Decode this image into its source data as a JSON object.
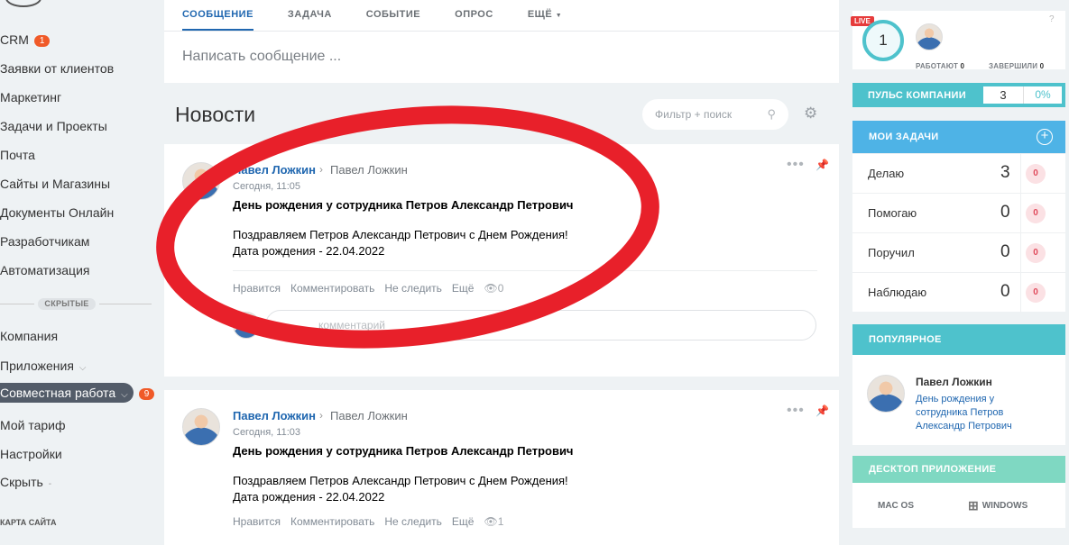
{
  "sidebar": {
    "items": [
      {
        "label": "CRM",
        "badge": "1"
      },
      {
        "label": "Заявки от клиентов"
      },
      {
        "label": "Маркетинг"
      },
      {
        "label": "Задачи и Проекты"
      },
      {
        "label": "Почта"
      },
      {
        "label": "Сайты и Магазины"
      },
      {
        "label": "Документы Онлайн"
      },
      {
        "label": "Разработчикам"
      },
      {
        "label": "Автоматизация"
      }
    ],
    "hidden_label": "СКРЫТЫЕ",
    "hidden_items": [
      {
        "label": "Компания"
      },
      {
        "label": "Приложения"
      },
      {
        "label": "Совместная работа",
        "badge": "9"
      },
      {
        "label": "Мой тариф"
      },
      {
        "label": "Настройки"
      },
      {
        "label": "Скрыть"
      }
    ],
    "sitemap": "КАРТА САЙТА"
  },
  "composer": {
    "tabs": [
      "СООБЩЕНИЕ",
      "ЗАДАЧА",
      "СОБЫТИЕ",
      "ОПРОС",
      "ЕЩЁ"
    ],
    "placeholder": "Написать сообщение ..."
  },
  "feed": {
    "title": "Новости",
    "filter_placeholder": "Фильтр + поиск",
    "posts": [
      {
        "author": "Павел Ложкин",
        "recipient": "Павел Ложкин",
        "time": "Сегодня, 11:05",
        "title": "День рождения у сотрудника Петров Александр Петрович",
        "body_line1": "Поздравляем Петров Александр Петрович с Днем Рождения!",
        "body_line2": "Дата рождения - 22.04.2022",
        "actions": {
          "like": "Нравится",
          "comment": "Комментировать",
          "unfollow": "Не следить",
          "more": "Ещё"
        },
        "views": "0",
        "comment_placeholder": "комментарий"
      },
      {
        "author": "Павел Ложкин",
        "recipient": "Павел Ложкин",
        "time": "Сегодня, 11:03",
        "title": "День рождения у сотрудника Петров Александр Петрович",
        "body_line1": "Поздравляем Петров Александр Петрович с Днем Рождения!",
        "body_line2": "Дата рождения - 22.04.2022",
        "actions": {
          "like": "Нравится",
          "comment": "Комментировать",
          "unfollow": "Не следить",
          "more": "Ещё"
        },
        "views": "1"
      }
    ]
  },
  "right": {
    "live": {
      "badge": "LIVE",
      "count": "1",
      "working_label": "РАБОТАЮТ",
      "working": "0",
      "done_label": "ЗАВЕРШИЛИ",
      "done": "0"
    },
    "pulse": {
      "label": "ПУЛЬС КОМПАНИИ",
      "count": "3",
      "percent": "0%"
    },
    "tasks": {
      "label": "МОИ ЗАДАЧИ",
      "rows": [
        {
          "label": "Делаю",
          "count": "3",
          "badge": "0"
        },
        {
          "label": "Помогаю",
          "count": "0",
          "badge": "0"
        },
        {
          "label": "Поручил",
          "count": "0",
          "badge": "0"
        },
        {
          "label": "Наблюдаю",
          "count": "0",
          "badge": "0"
        }
      ]
    },
    "popular": {
      "label": "ПОПУЛЯРНОЕ",
      "name": "Павел Ложкин",
      "link": "День рождения у сотрудника Петров Александр Петрович"
    },
    "desktop": {
      "label": "ДЕСКТОП ПРИЛОЖЕНИЕ",
      "mac": "MAC OS",
      "windows": "WINDOWS"
    }
  },
  "colors": {
    "accent": "#2067b0",
    "pulse": "#4ec2cc",
    "tasks": "#4eb3e6",
    "annotation": "#e8202a"
  }
}
